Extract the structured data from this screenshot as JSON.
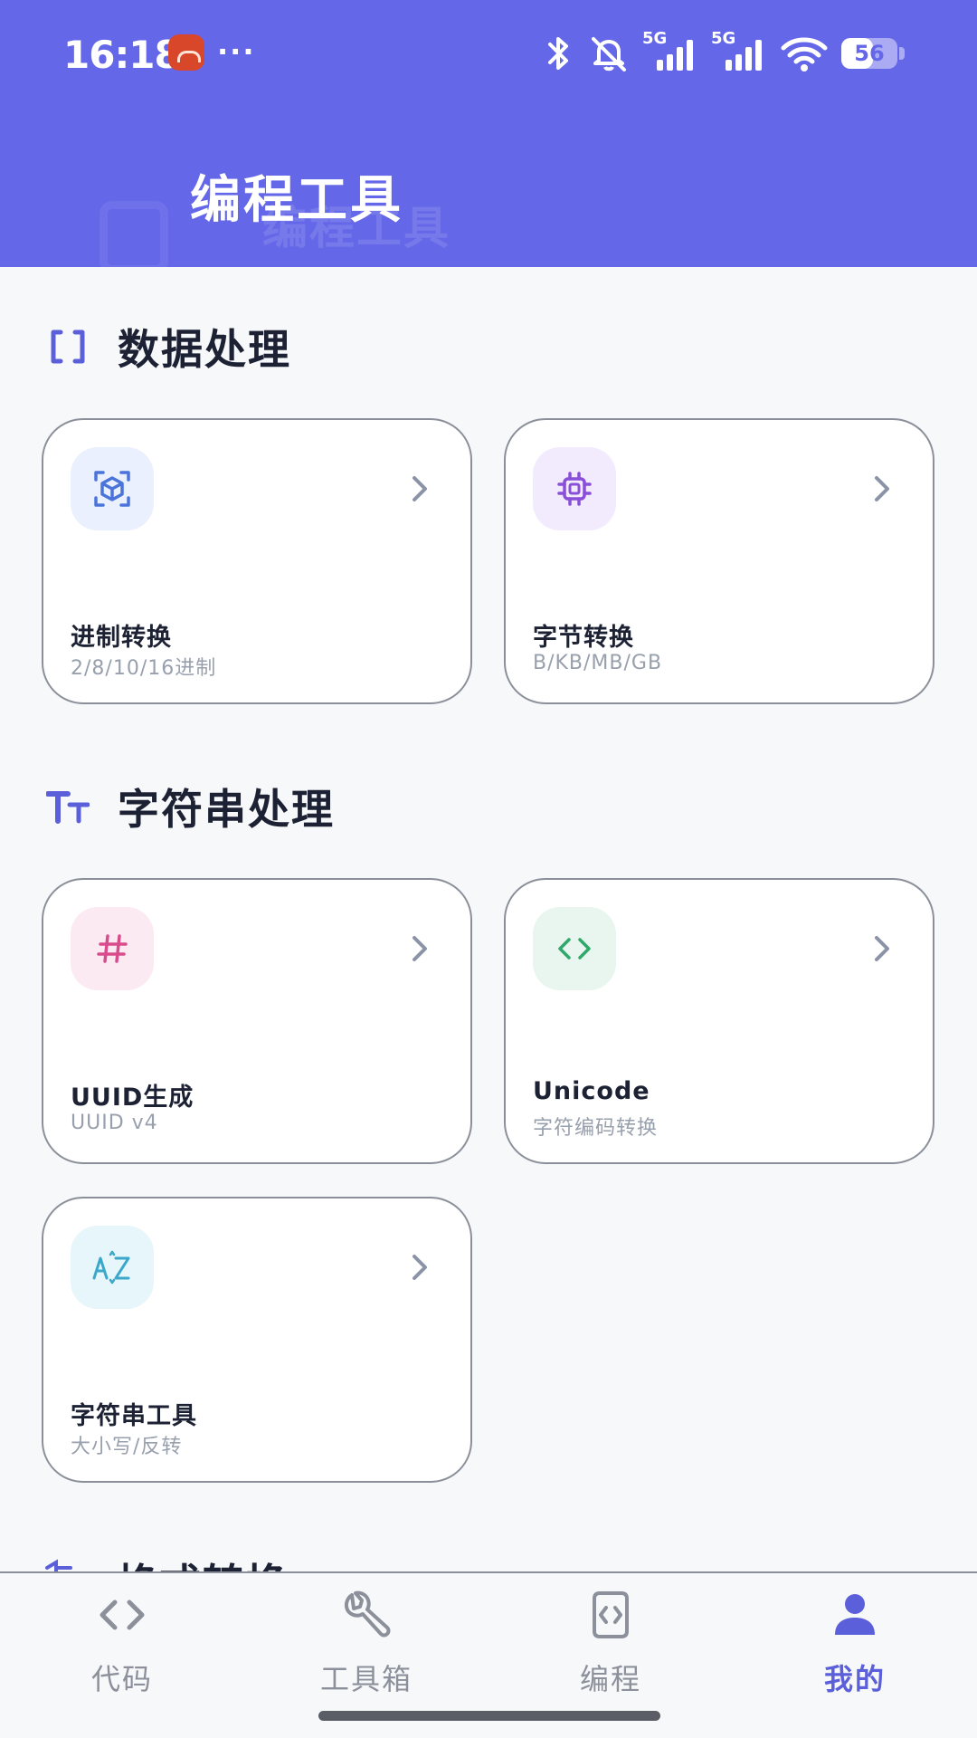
{
  "status_bar": {
    "time": "16:18",
    "more_indicator": "···",
    "network_1": "5G",
    "network_2": "5G",
    "battery_level": "56",
    "battery_percent": 56
  },
  "header": {
    "title": "编程工具",
    "ghost_title": "编程工具"
  },
  "colors": {
    "accent": "#6467E8",
    "nav_active": "#5B5FD9",
    "nav_inactive": "#8B909A"
  },
  "sections": [
    {
      "title": "数据处理",
      "icon": "brackets-icon",
      "cards": [
        {
          "title": "进制转换",
          "subtitle": "2/8/10/16进制",
          "icon": "cube-scan-icon",
          "icon_bg": "#EAF0FD",
          "icon_color": "#4A74D9"
        },
        {
          "title": "字节转换",
          "subtitle": "B/KB/MB/GB",
          "icon": "chip-icon",
          "icon_bg": "#F1EBFD",
          "icon_color": "#8A4FD8"
        }
      ]
    },
    {
      "title": "字符串处理",
      "icon": "text-size-icon",
      "cards": [
        {
          "title": "UUID生成",
          "subtitle": "UUID v4",
          "icon": "hash-icon",
          "icon_bg": "#FCEAF3",
          "icon_color": "#D94C8C"
        },
        {
          "title": "Unicode",
          "subtitle": "字符编码转换",
          "icon": "code-icon",
          "icon_bg": "#E8F6EF",
          "icon_color": "#2FA86A"
        },
        {
          "title": "字符串工具",
          "subtitle": "大小写/反转",
          "icon": "az-sort-icon",
          "icon_bg": "#E7F6FB",
          "icon_color": "#3BA7C9"
        }
      ]
    },
    {
      "title": "格式转换",
      "icon": "format-icon"
    }
  ],
  "bottom_nav": [
    {
      "label": "代码",
      "icon": "code-icon",
      "active": false
    },
    {
      "label": "工具箱",
      "icon": "wrench-icon",
      "active": false
    },
    {
      "label": "编程",
      "icon": "code-doc-icon",
      "active": false
    },
    {
      "label": "我的",
      "icon": "person-icon",
      "active": true
    }
  ]
}
